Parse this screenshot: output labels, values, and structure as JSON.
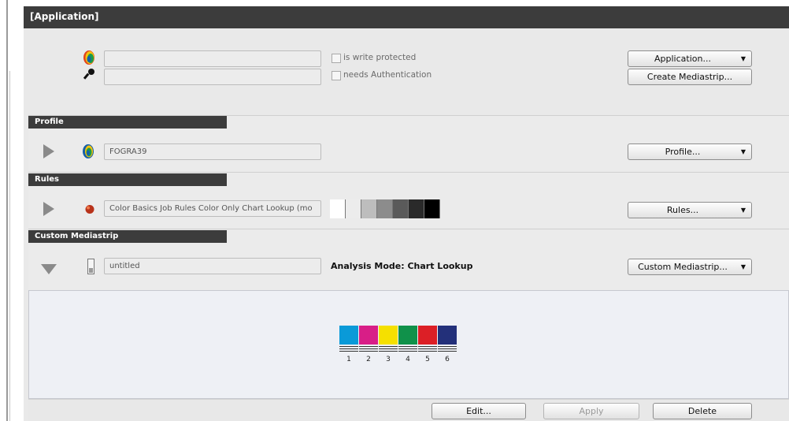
{
  "window": {
    "title": "[Application]"
  },
  "application": {
    "name_field": {
      "value": ""
    },
    "auth_field": {
      "value": ""
    },
    "write_protected": {
      "label": "is write protected",
      "checked": false
    },
    "needs_auth": {
      "label": "needs Authentication",
      "checked": false
    },
    "application_button": "Application...",
    "create_mediastrip_button": "Create Mediastrip..."
  },
  "profile": {
    "header": "Profile",
    "value": "FOGRA39",
    "button": "Profile..."
  },
  "rules": {
    "header": "Rules",
    "value": "Color Basics Job Rules Color Only Chart Lookup (mo",
    "button": "Rules...",
    "gray_ramp": [
      "#ffffff",
      "#ececec",
      "#bdbdbd",
      "#8c8c8c",
      "#5a5a5a",
      "#2a2a2a",
      "#000000"
    ]
  },
  "custom_mediastrip": {
    "header": "Custom Mediastrip",
    "value": "untitled",
    "analysis_mode": "Analysis Mode: Chart Lookup",
    "button": "Custom Mediastrip..."
  },
  "mediastrip_preview": {
    "patches": [
      {
        "number": "1",
        "color": "#0a9ad8"
      },
      {
        "number": "2",
        "color": "#d81e87"
      },
      {
        "number": "3",
        "color": "#f5e000"
      },
      {
        "number": "4",
        "color": "#10914a"
      },
      {
        "number": "5",
        "color": "#dc1f26"
      },
      {
        "number": "6",
        "color": "#23307a"
      }
    ]
  },
  "footer": {
    "edit_button": "Edit...",
    "apply_button": "Apply",
    "delete_button": "Delete"
  },
  "icons": {
    "application": "application-logo-icon",
    "auth": "key-icon",
    "profile": "profile-icon",
    "rules": "rules-icon",
    "mediastrip": "mediastrip-icon"
  }
}
